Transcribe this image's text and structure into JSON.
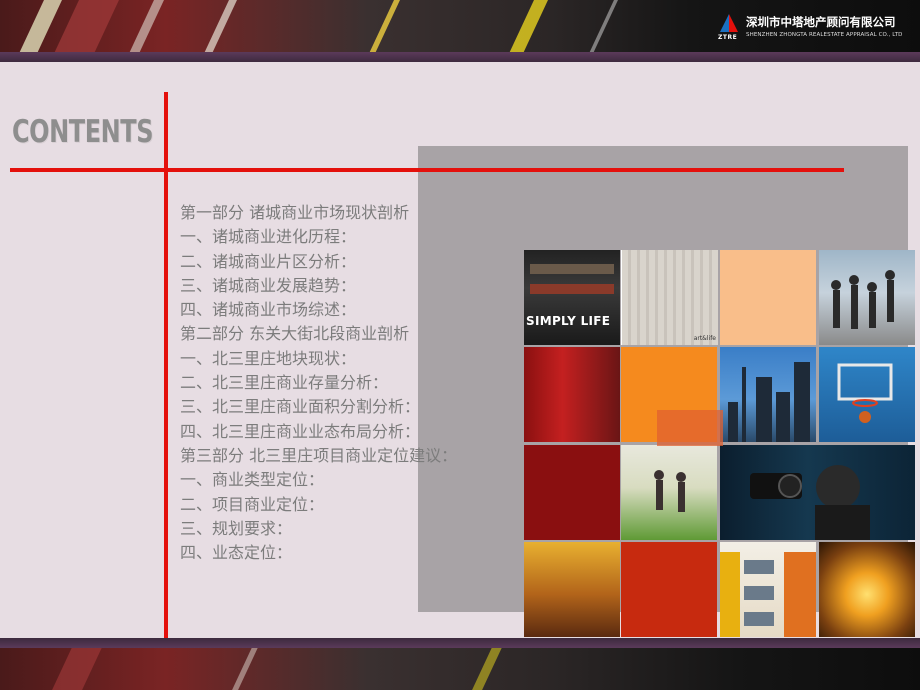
{
  "header": {
    "logo_mark_text": "ZTRE",
    "company_cn": "深圳市中塔地产顾问有限公司",
    "company_en": "SHENZHEN ZHONGTA REALESTATE APPRAISAL CO., LTD"
  },
  "title": "CONTENTS",
  "toc": [
    "第一部分  诸城商业市场现状剖析",
    "一、诸城商业进化历程：",
    "二、诸城商业片区分析：",
    "三、诸城商业发展趋势：",
    "四、诸城商业市场综述：",
    "第二部分  东关大街北段商业剖析",
    "一、北三里庄地块现状：",
    "二、北三里庄商业存量分析：",
    "三、北三里庄商业面积分割分析：",
    "四、北三里庄商业业态布局分析：",
    "第三部分  北三里庄项目商业定位建议：",
    "一、商业类型定位：",
    "二、项目商业定位：",
    "三、规划要求：",
    "四、业态定位："
  ],
  "collage": {
    "store_sign": "SIMPLY LIFE",
    "beads_caption": "art&life"
  },
  "colors": {
    "accent_red": "#e4100c",
    "background": "#e7dde3",
    "title_gray": "#8e8e8e",
    "text_gray": "#7c7c7c",
    "block_gray": "#a8a3a6"
  }
}
